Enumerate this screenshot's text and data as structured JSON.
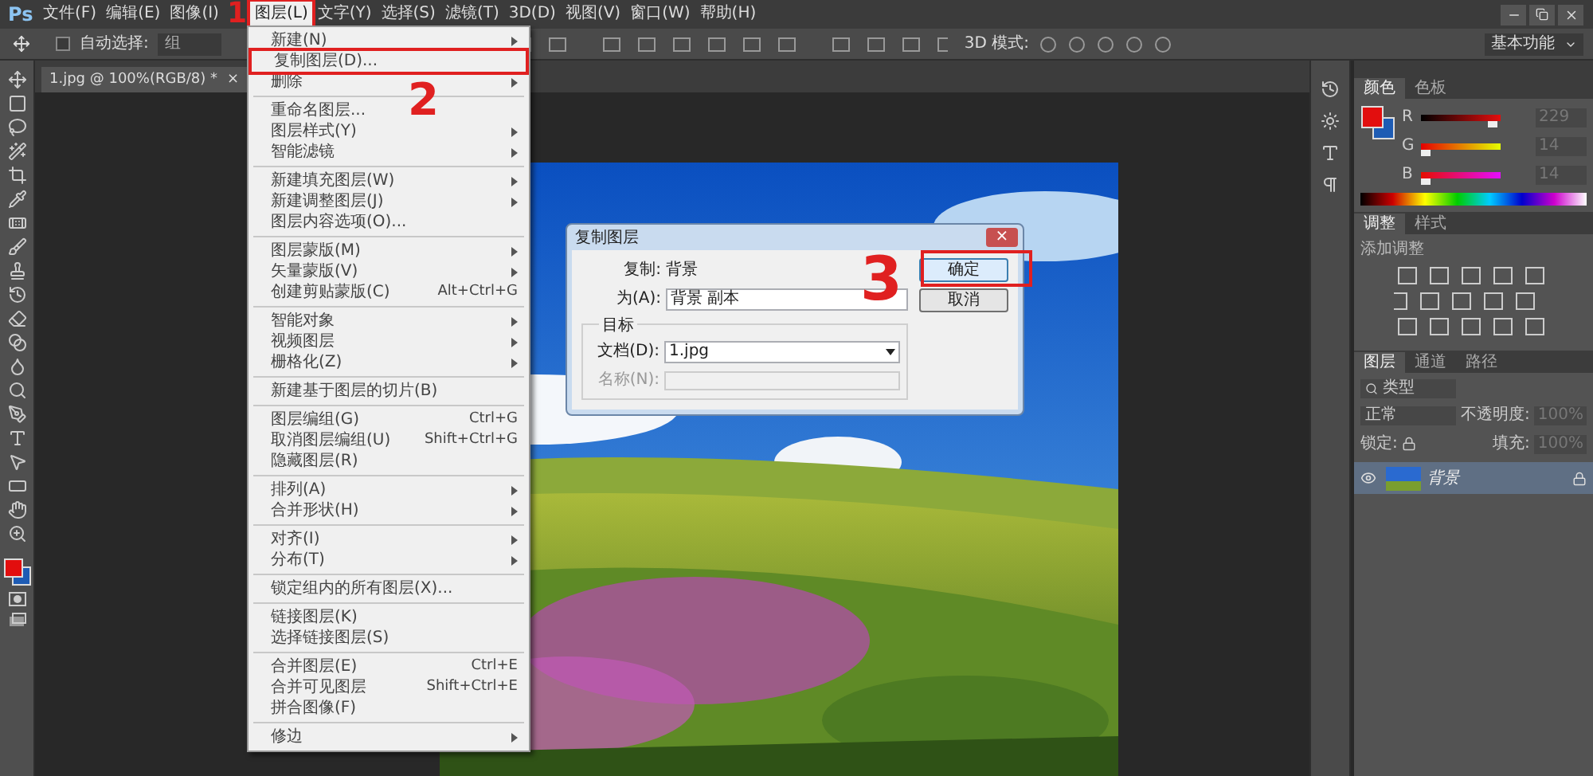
{
  "app": {
    "logo": "Ps"
  },
  "menu_bar": [
    {
      "label": "文件(F)",
      "selected": false
    },
    {
      "label": "编辑(E)",
      "selected": false
    },
    {
      "label": "图像(I)",
      "selected": false
    },
    {
      "label": "图层(L)",
      "selected": true
    },
    {
      "label": "文字(Y)",
      "selected": false
    },
    {
      "label": "选择(S)",
      "selected": false
    },
    {
      "label": "滤镜(T)",
      "selected": false
    },
    {
      "label": "3D(D)",
      "selected": false
    },
    {
      "label": "视图(V)",
      "selected": false
    },
    {
      "label": "窗口(W)",
      "selected": false
    },
    {
      "label": "帮助(H)",
      "selected": false
    }
  ],
  "options_bar": {
    "auto_select_label": "自动选择:",
    "auto_select_checked": false,
    "target": "组",
    "mode_label": "3D 模式:",
    "workspace": "基本功能"
  },
  "document_tab": {
    "title": "1.jpg @ 100%(RGB/8) *",
    "close": "×"
  },
  "layer_menu": {
    "groups": [
      [
        {
          "label": "新建(N)",
          "submenu": true
        },
        {
          "label": "复制图层(D)...",
          "submenu": false,
          "annotated": true
        },
        {
          "label": "删除",
          "submenu": true
        }
      ],
      [
        {
          "label": "重命名图层...",
          "submenu": false
        },
        {
          "label": "图层样式(Y)",
          "submenu": true
        },
        {
          "label": "智能滤镜",
          "submenu": true
        }
      ],
      [
        {
          "label": "新建填充图层(W)",
          "submenu": true
        },
        {
          "label": "新建调整图层(J)",
          "submenu": true
        },
        {
          "label": "图层内容选项(O)...",
          "submenu": false
        }
      ],
      [
        {
          "label": "图层蒙版(M)",
          "submenu": true
        },
        {
          "label": "矢量蒙版(V)",
          "submenu": true
        },
        {
          "label": "创建剪贴蒙版(C)",
          "submenu": false,
          "shortcut": "Alt+Ctrl+G"
        }
      ],
      [
        {
          "label": "智能对象",
          "submenu": true
        },
        {
          "label": "视频图层",
          "submenu": true
        },
        {
          "label": "栅格化(Z)",
          "submenu": true
        }
      ],
      [
        {
          "label": "新建基于图层的切片(B)",
          "submenu": false
        }
      ],
      [
        {
          "label": "图层编组(G)",
          "submenu": false,
          "shortcut": "Ctrl+G"
        },
        {
          "label": "取消图层编组(U)",
          "submenu": false,
          "shortcut": "Shift+Ctrl+G"
        },
        {
          "label": "隐藏图层(R)",
          "submenu": false
        }
      ],
      [
        {
          "label": "排列(A)",
          "submenu": true
        },
        {
          "label": "合并形状(H)",
          "submenu": true
        }
      ],
      [
        {
          "label": "对齐(I)",
          "submenu": true
        },
        {
          "label": "分布(T)",
          "submenu": true
        }
      ],
      [
        {
          "label": "锁定组内的所有图层(X)...",
          "submenu": false
        }
      ],
      [
        {
          "label": "链接图层(K)",
          "submenu": false
        },
        {
          "label": "选择链接图层(S)",
          "submenu": false
        }
      ],
      [
        {
          "label": "合并图层(E)",
          "submenu": false,
          "shortcut": "Ctrl+E"
        },
        {
          "label": "合并可见图层",
          "submenu": false,
          "shortcut": "Shift+Ctrl+E"
        },
        {
          "label": "拼合图像(F)",
          "submenu": false
        }
      ],
      [
        {
          "label": "修边",
          "submenu": true
        }
      ]
    ]
  },
  "dialog": {
    "title": "复制图层",
    "close": "×",
    "source_label": "复制:",
    "source": "背景",
    "as_label": "为(A):",
    "as_value": "背景 副本",
    "ok": "确定",
    "cancel": "取消",
    "group_title": "目标",
    "document_label": "文档(D):",
    "document": "1.jpg",
    "name_label": "名称(N):",
    "name_disabled": true
  },
  "color_panel": {
    "tabs": [
      {
        "label": "颜色",
        "selected": true
      },
      {
        "label": "色板",
        "selected": false
      }
    ],
    "channels": [
      {
        "name": "R",
        "value": "229",
        "level": 0.9
      },
      {
        "name": "G",
        "value": "14",
        "level": 0.05
      },
      {
        "name": "B",
        "value": "14",
        "level": 0.05
      }
    ]
  },
  "adjustments_panel": {
    "tabs": [
      {
        "label": "调整",
        "selected": true
      },
      {
        "label": "样式",
        "selected": false
      }
    ],
    "title": "添加调整"
  },
  "layers_panel": {
    "tabs": [
      {
        "label": "图层",
        "selected": true
      },
      {
        "label": "通道",
        "selected": false
      },
      {
        "label": "路径",
        "selected": false
      }
    ],
    "filter": "类型",
    "blend_mode": "正常",
    "opacity_label": "不透明度:",
    "opacity": "100%",
    "lock_label": "锁定:",
    "fill_label": "填充:",
    "fill": "100%",
    "layers": [
      {
        "name": "背景",
        "visible": true,
        "locked": true,
        "selected": true
      }
    ]
  },
  "annotations": [
    {
      "text": "1"
    },
    {
      "text": "2"
    },
    {
      "text": "3"
    }
  ]
}
